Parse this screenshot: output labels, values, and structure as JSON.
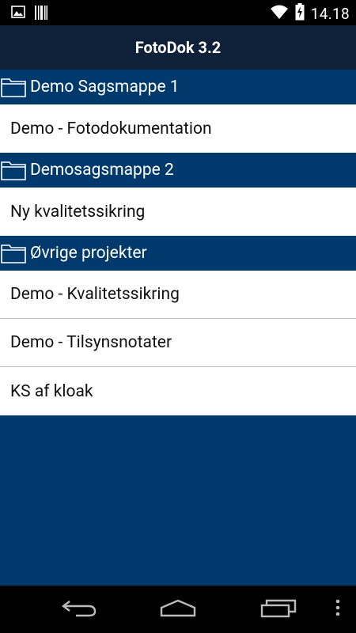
{
  "status_bar": {
    "time": "14.18",
    "icons": [
      "image-notification-icon",
      "barcode-notification-icon",
      "wifi-icon",
      "battery-charging-icon"
    ]
  },
  "app": {
    "title": "FotoDok 3.2"
  },
  "sections": [
    {
      "title": "Demo Sagsmappe 1",
      "items": [
        "Demo - Fotodokumentation"
      ]
    },
    {
      "title": "Demosagsmappe 2",
      "items": [
        "Ny kvalitetssikring"
      ]
    },
    {
      "title": "Øvrige projekter",
      "items": [
        "Demo - Kvalitetssikring",
        "Demo - Tilsynsnotater",
        "KS af kloak"
      ]
    }
  ],
  "nav": {
    "icons": [
      "back-icon",
      "home-icon",
      "recents-icon",
      "overflow-menu-icon"
    ]
  },
  "colors": {
    "background": "#003a6c",
    "action_bar": "#0f2138",
    "item": "#ffffff"
  }
}
